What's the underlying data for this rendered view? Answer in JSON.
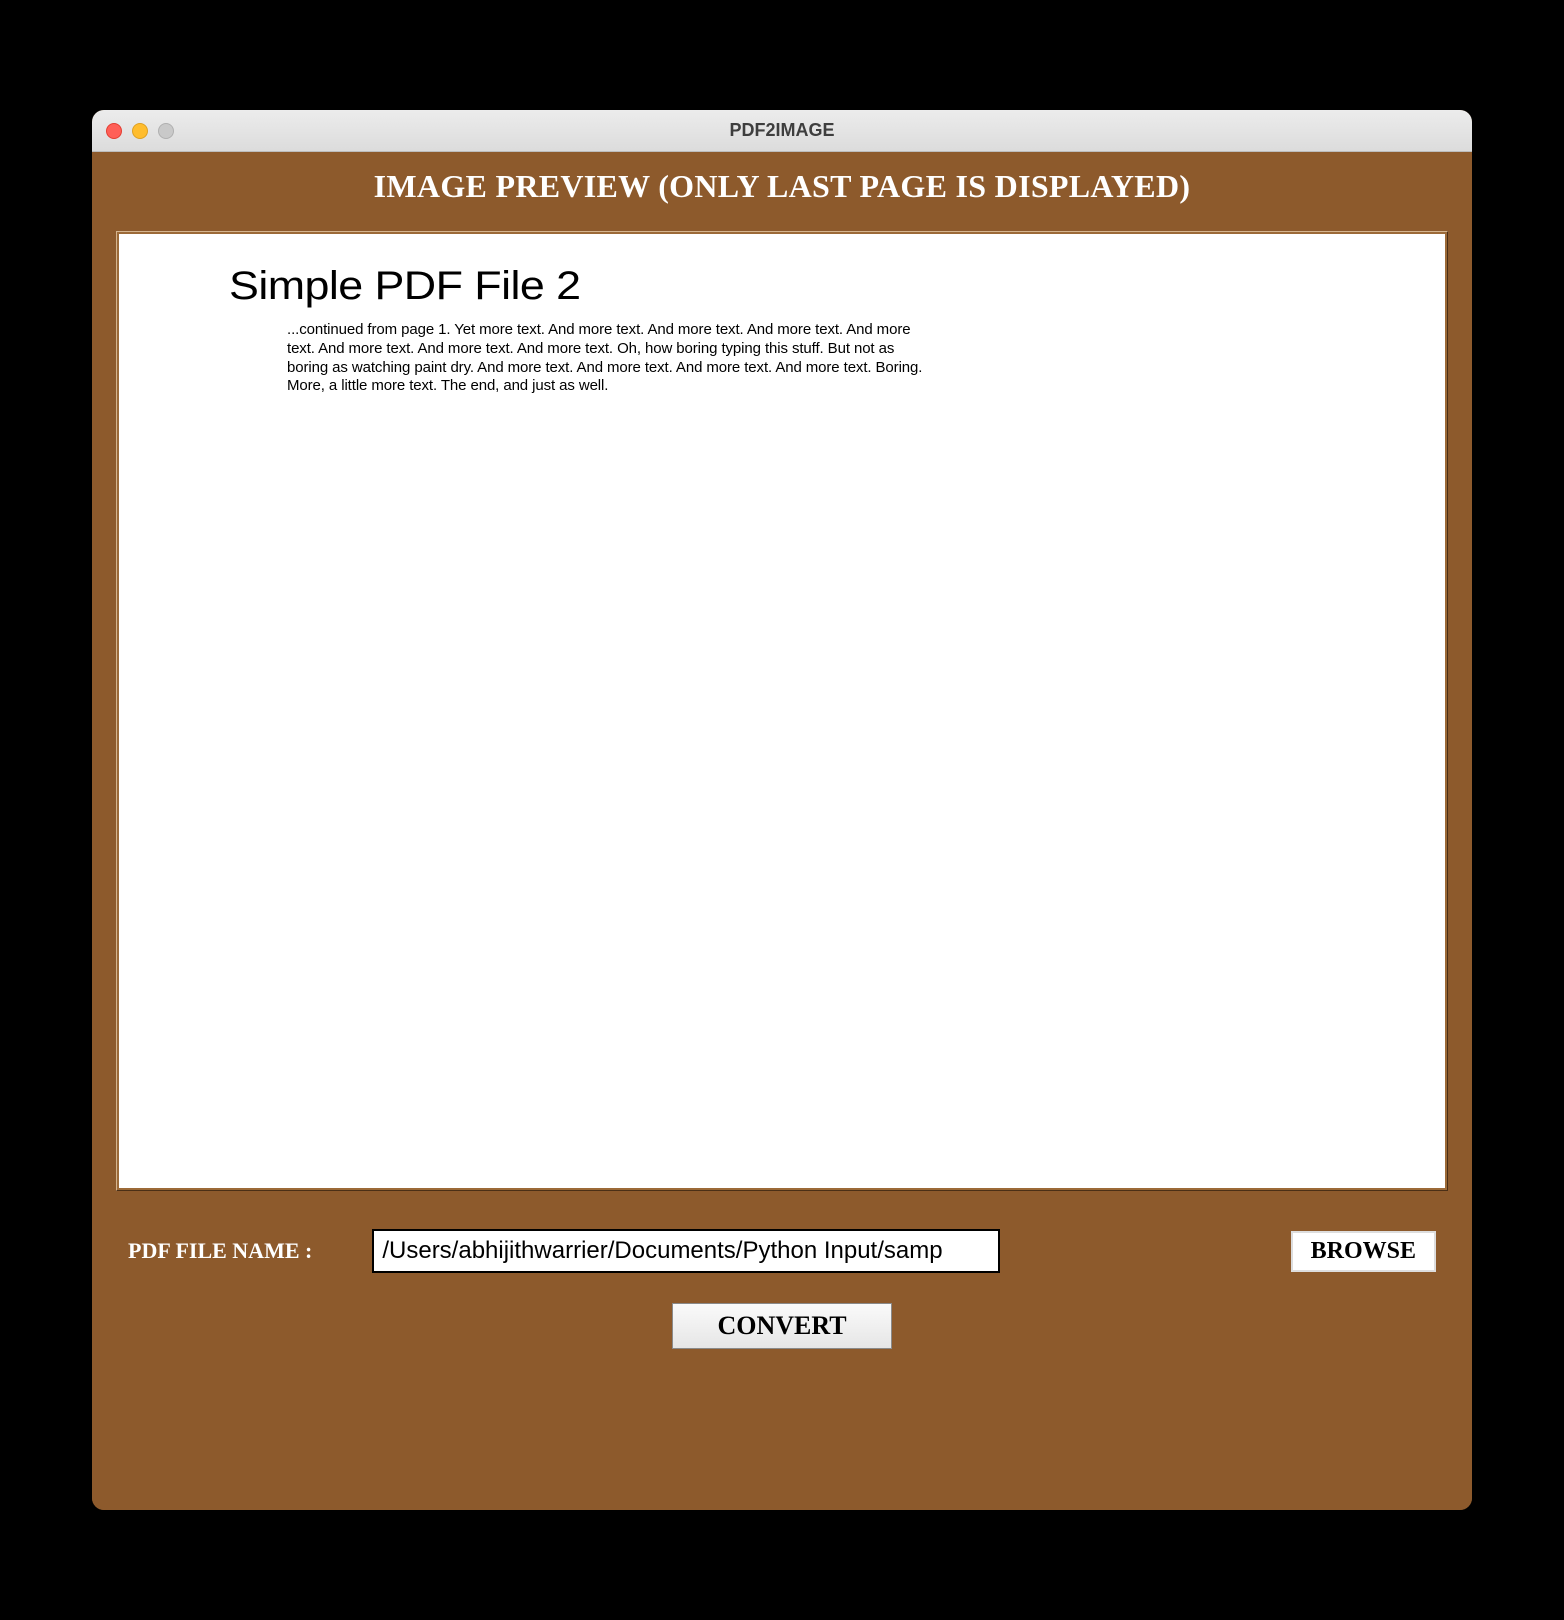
{
  "window": {
    "title": "PDF2IMAGE"
  },
  "heading": "IMAGE PREVIEW (ONLY LAST PAGE IS DISPLAYED)",
  "preview": {
    "pdf_page_title": "Simple PDF File 2",
    "pdf_page_body": "...continued from page 1. Yet more text. And more text. And more text. And more text. And more text. And more text. And more text. And more text. Oh, how boring typing this stuff. But not as boring as watching paint dry. And more text. And more text. And more text. And more text. Boring.  More, a little more text. The end, and just as well."
  },
  "form": {
    "file_label": "PDF FILE NAME :",
    "file_path": "/Users/abhijithwarrier/Documents/Python Input/samp",
    "browse_label": "BROWSE",
    "convert_label": "CONVERT"
  },
  "colors": {
    "window_bg": "#8d5a2c",
    "titlebar_bg": "#e3e3e3"
  }
}
